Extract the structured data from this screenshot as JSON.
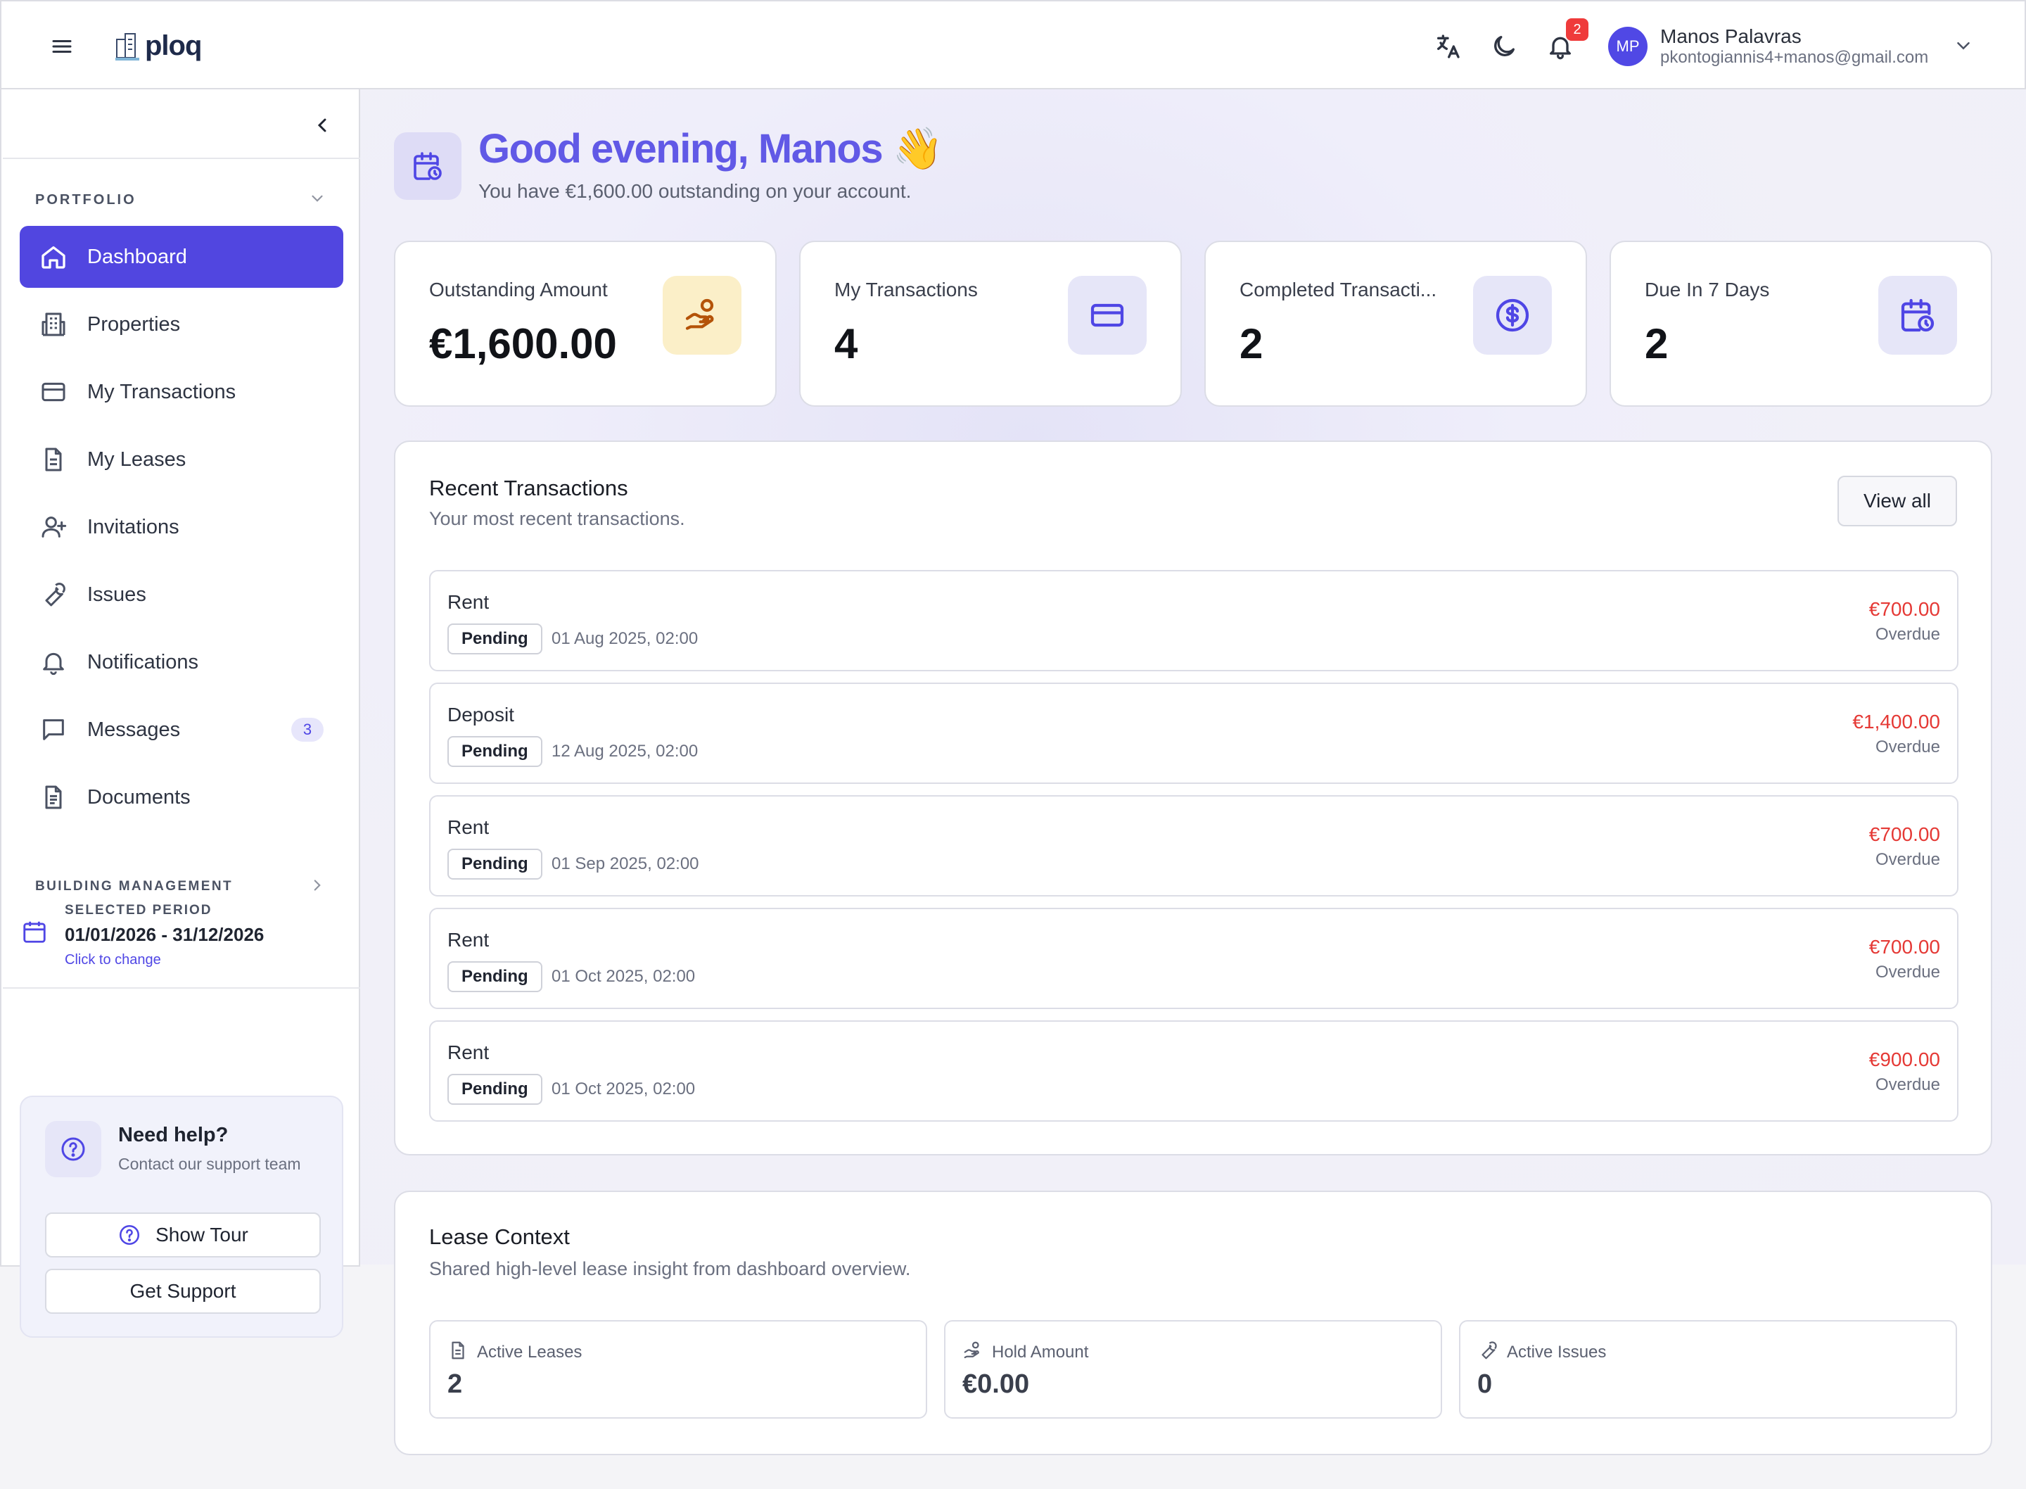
{
  "app": {
    "logo_text": "ploq"
  },
  "header": {
    "notification_count": "2",
    "user": {
      "initials": "MP",
      "name": "Manos Palavras",
      "email": "pkontogiannis4+manos@gmail.com"
    }
  },
  "sidebar": {
    "portfolio_label": "PORTFOLIO",
    "items": [
      {
        "label": "Dashboard",
        "icon": "home-icon",
        "active": true
      },
      {
        "label": "Properties",
        "icon": "building-icon"
      },
      {
        "label": "My Transactions",
        "icon": "credit-card-icon"
      },
      {
        "label": "My Leases",
        "icon": "document-icon"
      },
      {
        "label": "Invitations",
        "icon": "user-plus-icon"
      },
      {
        "label": "Issues",
        "icon": "wrench-icon"
      },
      {
        "label": "Notifications",
        "icon": "bell-icon"
      },
      {
        "label": "Messages",
        "icon": "message-icon",
        "badge": "3"
      },
      {
        "label": "Documents",
        "icon": "file-icon"
      }
    ],
    "building_label": "BUILDING MANAGEMENT",
    "period": {
      "label": "SELECTED PERIOD",
      "value": "01/01/2026 - 31/12/2026",
      "link": "Click to change"
    },
    "help": {
      "title": "Need help?",
      "subtitle": "Contact our support team",
      "tour_button": "Show Tour",
      "support_button": "Get Support"
    }
  },
  "greeting": {
    "title": "Good evening, Manos 👋",
    "subtitle": "You have €1,600.00 outstanding on your account."
  },
  "stats": [
    {
      "label": "Outstanding Amount",
      "value": "€1,600.00",
      "icon": "hand-coins-icon"
    },
    {
      "label": "My Transactions",
      "value": "4",
      "icon": "credit-card-icon"
    },
    {
      "label": "Completed Transacti...",
      "value": "2",
      "icon": "dollar-circle-icon"
    },
    {
      "label": "Due In 7 Days",
      "value": "2",
      "icon": "calendar-clock-icon"
    }
  ],
  "recent": {
    "title": "Recent Transactions",
    "subtitle": "Your most recent transactions.",
    "view_all": "View all",
    "rows": [
      {
        "title": "Rent",
        "badge": "Pending",
        "date": "01 Aug 2025, 02:00",
        "amount": "€700.00",
        "status": "Overdue"
      },
      {
        "title": "Deposit",
        "badge": "Pending",
        "date": "12 Aug 2025, 02:00",
        "amount": "€1,400.00",
        "status": "Overdue"
      },
      {
        "title": "Rent",
        "badge": "Pending",
        "date": "01 Sep 2025, 02:00",
        "amount": "€700.00",
        "status": "Overdue"
      },
      {
        "title": "Rent",
        "badge": "Pending",
        "date": "01 Oct 2025, 02:00",
        "amount": "€700.00",
        "status": "Overdue"
      },
      {
        "title": "Rent",
        "badge": "Pending",
        "date": "01 Oct 2025, 02:00",
        "amount": "€900.00",
        "status": "Overdue"
      }
    ]
  },
  "lease": {
    "title": "Lease Context",
    "subtitle": "Shared high-level lease insight from dashboard overview.",
    "cards": [
      {
        "label": "Active Leases",
        "value": "2",
        "icon": "document-icon"
      },
      {
        "label": "Hold Amount",
        "value": "€0.00",
        "icon": "hand-coins-icon"
      },
      {
        "label": "Active Issues",
        "value": "0",
        "icon": "wrench-icon"
      }
    ]
  },
  "colors": {
    "accent": "#5146e0",
    "overdue": "#e53935",
    "badge_red": "#ef3b3b"
  }
}
